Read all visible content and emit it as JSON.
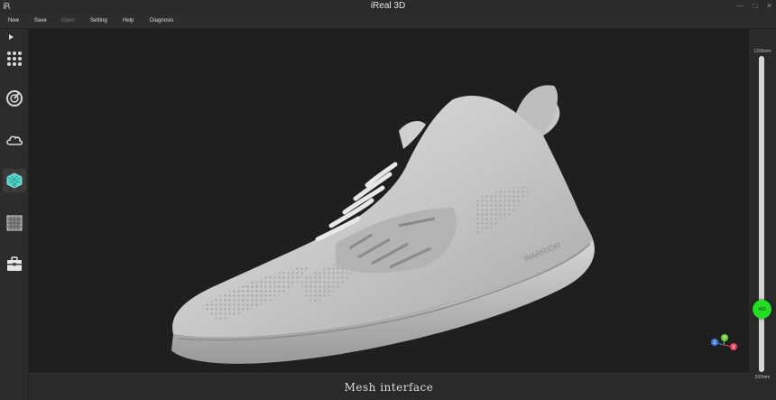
{
  "window": {
    "logo": "iR",
    "title": "iReal 3D"
  },
  "menu": [
    {
      "label": "New",
      "enabled": true
    },
    {
      "label": "Save",
      "enabled": true
    },
    {
      "label": "Open",
      "enabled": false
    },
    {
      "label": "Setting",
      "enabled": true
    },
    {
      "label": "Help",
      "enabled": true
    },
    {
      "label": "Diagnosis",
      "enabled": true
    }
  ],
  "sidebar": {
    "tools": [
      {
        "icon": "grid-dots-icon",
        "active": false
      },
      {
        "icon": "target-icon",
        "active": false
      },
      {
        "icon": "cloud-icon",
        "active": false
      },
      {
        "icon": "mesh-cube-icon",
        "active": true
      },
      {
        "icon": "grid-square-icon",
        "active": false
      },
      {
        "icon": "toolbox-icon",
        "active": false
      }
    ]
  },
  "viewport": {
    "model": "shoe-mesh",
    "brand_text": "WARRIOR",
    "axis": {
      "x": "X",
      "y": "Y",
      "z": "Z"
    }
  },
  "status": {
    "text": "Mesh interface"
  },
  "slider": {
    "max_label": "1200mm",
    "min_label": "200mm",
    "min": 200,
    "max": 1200,
    "value": 400,
    "value_label": "400",
    "thumb_color": "#22dd22"
  },
  "colors": {
    "accent_active": "#4fd4c8",
    "background": "#1f1f1f"
  }
}
